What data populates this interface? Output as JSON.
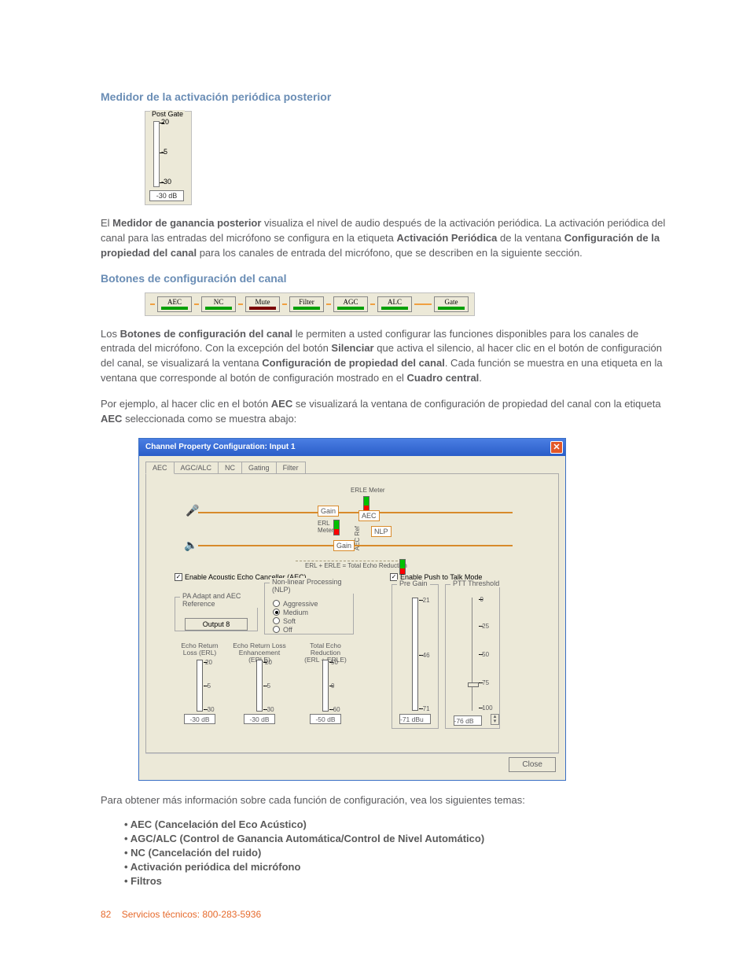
{
  "headings": {
    "h1": "Medidor de la activación periódica posterior",
    "h2": "Botones de configuración del canal"
  },
  "postGate": {
    "title": "Post Gate",
    "ticks": [
      "20",
      "-5",
      "-30"
    ],
    "readout": "-30 dB"
  },
  "para1": {
    "prefix": "El ",
    "b1": "Medidor de ganancia posterior",
    "mid1": " visualiza el nivel de audio después de la activación periódica. La activación periódica del canal para las entradas del micrófono se configura en la etiqueta ",
    "b2": "Activación Periódica",
    "mid2": " de la ventana ",
    "b3": "Configuración de la propiedad del canal",
    "end": " para los canales de entrada del micrófono, que se describen en la siguiente sección."
  },
  "chanButtons": [
    "AEC",
    "NC",
    "Mute",
    "Filter",
    "AGC",
    "ALC",
    "Gate"
  ],
  "para2": {
    "prefix": "Los ",
    "b1": "Botones de configuración del canal",
    "mid1": " le permiten a usted configurar las funciones disponibles para los canales de entrada del micrófono. Con la excepción del botón ",
    "b2": "Silenciar",
    "mid2": " que activa el silencio, al hacer clic en el botón de configuración del canal, se visualizará la ventana ",
    "b3": "Configuración de propiedad del canal",
    "mid3": ". Cada función se muestra en una etiqueta en la ventana que corresponde al botón de configuración mostrado en el ",
    "b4": "Cuadro central",
    "end": "."
  },
  "para3": {
    "prefix": "Por ejemplo, al hacer clic en el botón ",
    "b1": "AEC",
    "mid1": " se visualizará la ventana de configuración de propiedad del canal con la etiqueta ",
    "b2": "AEC",
    "end": " seleccionada como se muestra abajo:"
  },
  "dialog": {
    "title": "Channel Property Configuration: Input 1",
    "tabs": [
      "AEC",
      "AGC/ALC",
      "NC",
      "Gating",
      "Filter"
    ],
    "diagram": {
      "erleMeter": "ERLE Meter",
      "gain1": "Gain",
      "gain2": "Gain",
      "aec": "AEC",
      "nlp": "NLP",
      "erlMeter": "ERL\nMeter",
      "aecRef": "AEC Ref",
      "totalEcho": "ERL + ERLE = Total Echo Reduction"
    },
    "enableAEC": "Enable Acoustic Echo Canceller (AEC)",
    "paGroup": {
      "title": "PA Adapt and AEC Reference",
      "value": "Output 8"
    },
    "nlpGroup": {
      "title": "Non-linear Processing (NLP)",
      "options": [
        "Aggressive",
        "Medium",
        "Soft",
        "Off"
      ]
    },
    "vmeters": [
      {
        "title": "Echo Return\nLoss (ERL)",
        "ticks": [
          "20",
          "-5",
          "-30"
        ],
        "readout": "-30 dB"
      },
      {
        "title": "Echo Return Loss\nEnhancement (ERLE)",
        "ticks": [
          "20",
          "-5",
          "-30"
        ],
        "readout": "-30 dB"
      },
      {
        "title": "Total Echo Reduction\n(ERL + ERLE)",
        "ticks": [
          "50",
          "0",
          "-60"
        ],
        "readout": "-50 dB"
      }
    ],
    "enablePTT": "Enable Push to Talk Mode",
    "preGain": {
      "title": "Pre Gain",
      "ticks": [
        "-21",
        "-46",
        "-71"
      ],
      "readout": "-71 dBu"
    },
    "pttThreshold": {
      "title": "PTT Threshold",
      "ticks": [
        "0",
        "-25",
        "-50",
        "-75",
        "-100"
      ],
      "readout": "-76 dB"
    },
    "close": "Close"
  },
  "para4": "Para obtener más información sobre cada función de configuración, vea los siguientes temas:",
  "bullets": [
    "AEC (Cancelación del Eco Acústico)",
    "AGC/ALC (Control de Ganancia Automática/Control de Nivel Automático)",
    "NC (Cancelación del ruido)",
    "Activación periódica del micrófono",
    "Filtros"
  ],
  "footer": {
    "page": "82",
    "svc": "Servicios técnicos: 800-283-5936"
  }
}
